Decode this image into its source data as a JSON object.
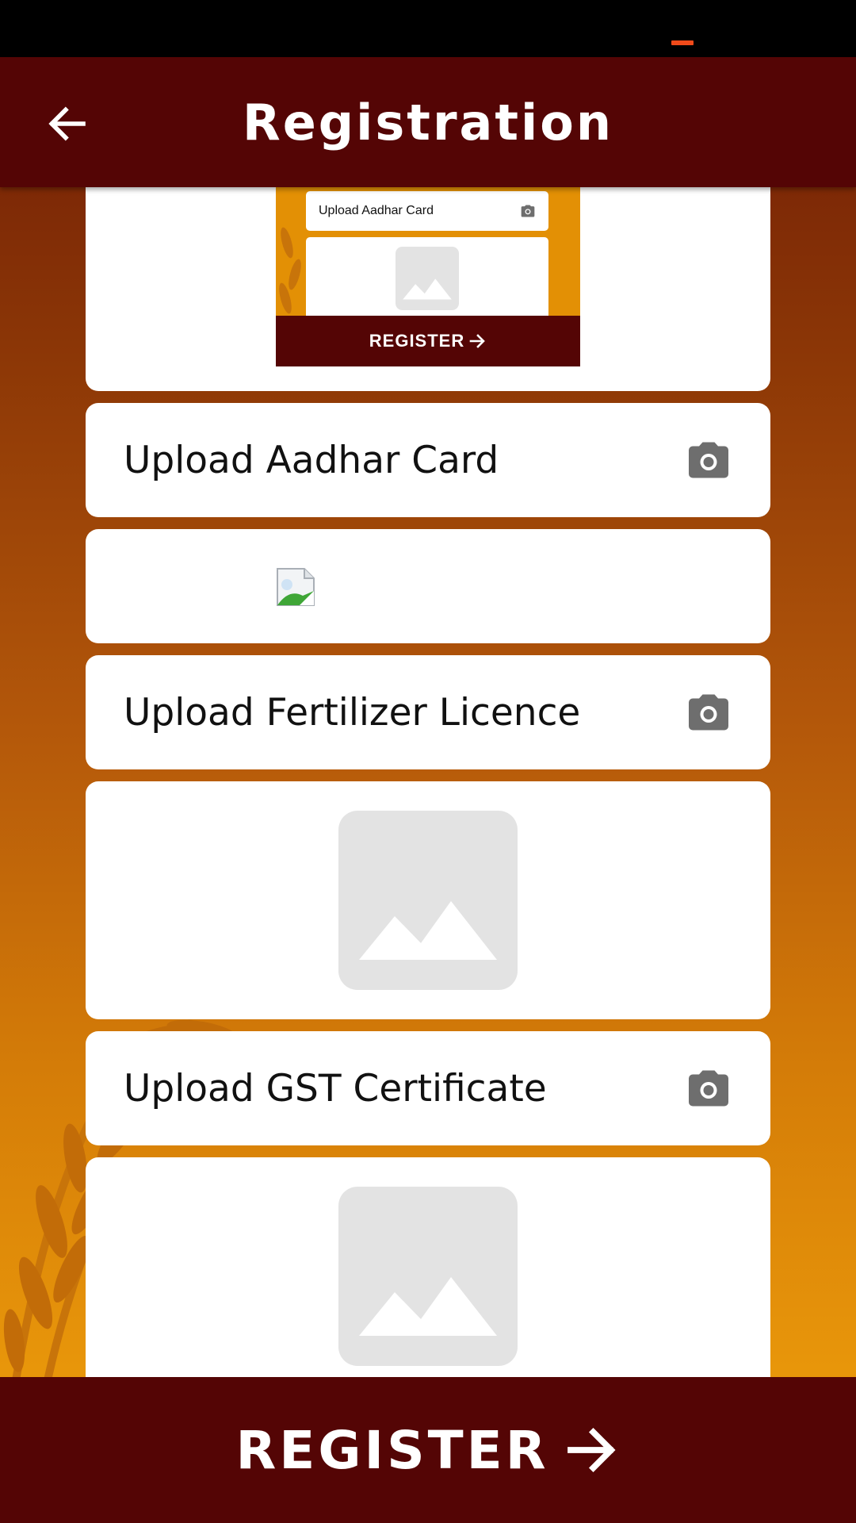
{
  "app_bar": {
    "title": "Registration",
    "back_icon": "arrow-left-icon"
  },
  "preview_thumbnail": {
    "upload_label": "Upload Aadhar Card",
    "camera_icon": "camera-icon",
    "image_icon": "image-placeholder-icon",
    "register_label": "REGISTER"
  },
  "uploads": [
    {
      "label": "Upload Aadhar Card",
      "icon": "camera-icon",
      "preview": "broken-image-icon"
    },
    {
      "label": "Upload Fertilizer Licence",
      "icon": "camera-icon",
      "preview": "image-placeholder-icon"
    },
    {
      "label": "Upload GST Certificate",
      "icon": "camera-icon",
      "preview": "image-placeholder-icon"
    }
  ],
  "footer": {
    "register_label": "REGISTER",
    "register_icon": "arrow-right-icon"
  },
  "colors": {
    "app_bar": "#540505",
    "gradient_top": "#6e1a06",
    "gradient_bottom": "#ec9c0a",
    "icon_gray": "#6e6e6e",
    "placeholder_gray": "#e3e3e3",
    "status_indicator": "#f04a1a"
  }
}
